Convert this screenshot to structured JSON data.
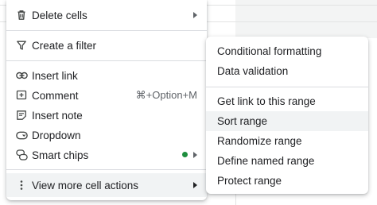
{
  "colors": {
    "highlight": "#f1f3f4",
    "smart_chips_dot": "#1e8e3e",
    "icon": "#444746"
  },
  "menu": {
    "items": [
      {
        "label": "Delete cells",
        "icon": "trash-icon",
        "has_submenu": true
      },
      {
        "label": "Create a filter",
        "icon": "filter-icon"
      },
      {
        "label": "Insert link",
        "icon": "link-icon"
      },
      {
        "label": "Comment",
        "icon": "comment-icon",
        "shortcut": "⌘+Option+M"
      },
      {
        "label": "Insert note",
        "icon": "note-icon"
      },
      {
        "label": "Dropdown",
        "icon": "dropdown-chip-icon"
      },
      {
        "label": "Smart chips",
        "icon": "smart-chips-icon",
        "has_submenu": true
      },
      {
        "label": "View more cell actions",
        "icon": "more-vertical-icon",
        "has_submenu": true,
        "highlighted": true
      }
    ]
  },
  "submenu": {
    "items": [
      {
        "label": "Conditional formatting"
      },
      {
        "label": "Data validation"
      },
      {
        "label": "Get link to this range"
      },
      {
        "label": "Sort range",
        "highlighted": true
      },
      {
        "label": "Randomize range"
      },
      {
        "label": "Define named range"
      },
      {
        "label": "Protect range"
      }
    ]
  }
}
